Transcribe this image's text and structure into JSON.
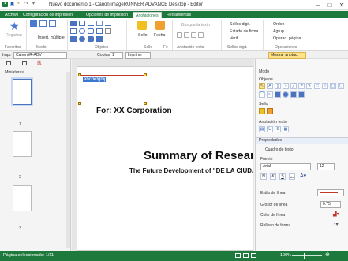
{
  "window": {
    "title": "Nuevo documento 1 - Canon imageRUNNER ADVANCE Desktop - Editor"
  },
  "tabs": [
    "Archivo",
    "Configuración de impresión",
    "Opciones de impresión",
    "Anotaciones",
    "Herramientas"
  ],
  "ribbon": {
    "registrar": "Registrar",
    "insert_multiple": "Insert. múltiple",
    "search_text": "Búsqueda texto",
    "sello": "Sello",
    "fecha": "Fecha",
    "sellos_digit": "Sellos digit.",
    "estado_firma": "Estado de firma",
    "verif": "Verif.",
    "orden": "Orden",
    "agrup": "Agrup.",
    "operac_pagina": "Operac. página",
    "mostrar_anotac": "Mostrar anotac.",
    "groups": [
      "Favoritos",
      "Modo",
      "Objetos",
      "Sello",
      "Fe",
      "Anotación texto",
      "Sellos digit.",
      "Operaciones"
    ]
  },
  "printer_row": {
    "label": "Impr.",
    "printer": "Canon iR-ADV",
    "copies_label": "Copias",
    "copies": "1",
    "print_btn": "Imprimir"
  },
  "left_panel": {
    "title": "Miniaturas",
    "pages": [
      "1",
      "2",
      "3"
    ]
  },
  "document": {
    "textbox": "abcdefghij",
    "for_line": "For: XX Corporation",
    "heading": "Summary of Resear",
    "subheading": "The Future Development of \"DE LA CIUDA"
  },
  "right_panel": {
    "modo": "Modo",
    "objetos": "Objetos",
    "sello": "Sello",
    "anotacion_texto": "Anotación texto",
    "propiedades": "Propiedades",
    "object_type": "Cuadro de texto",
    "fuente": "Fuente",
    "font_name": "Arial",
    "font_size": "12",
    "bold": "N",
    "italic": "K",
    "underline": "S",
    "strike": "abc",
    "estilo_linea": "Estilo de línea",
    "grosor_linea": "Grosor de línea",
    "grosor_value": "0.75",
    "color_linea": "Color de línea",
    "relleno_forma": "Relleno de forma"
  },
  "status": {
    "text": "Página seleccionada: 1/11",
    "zoom": "100%"
  },
  "colors": {
    "accent": "#1e7a3c",
    "selection": "#c0392b",
    "highlight": "#ffd24d"
  }
}
